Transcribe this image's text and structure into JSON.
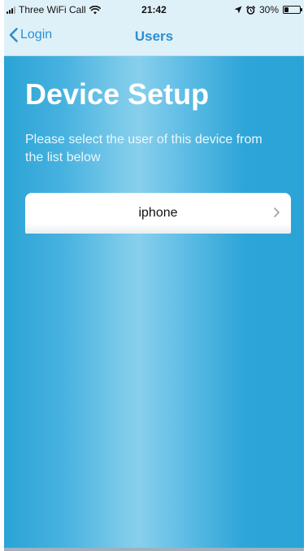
{
  "status_bar": {
    "carrier": "Three WiFi Call",
    "time": "21:42",
    "battery_percent": "30%",
    "battery_level": 0.3,
    "icons": [
      "signal-icon",
      "wifi-icon",
      "location-icon",
      "alarm-icon",
      "battery-icon"
    ]
  },
  "nav": {
    "back_label": "Login",
    "title": "Users"
  },
  "main": {
    "heading": "Device Setup",
    "instructions": "Please select the user of this device from the list below",
    "users": [
      {
        "name": "iphone"
      }
    ]
  },
  "colors": {
    "accent": "#2b8fd2",
    "background": "#2aa5d7",
    "nav_background": "#dff1f8"
  }
}
